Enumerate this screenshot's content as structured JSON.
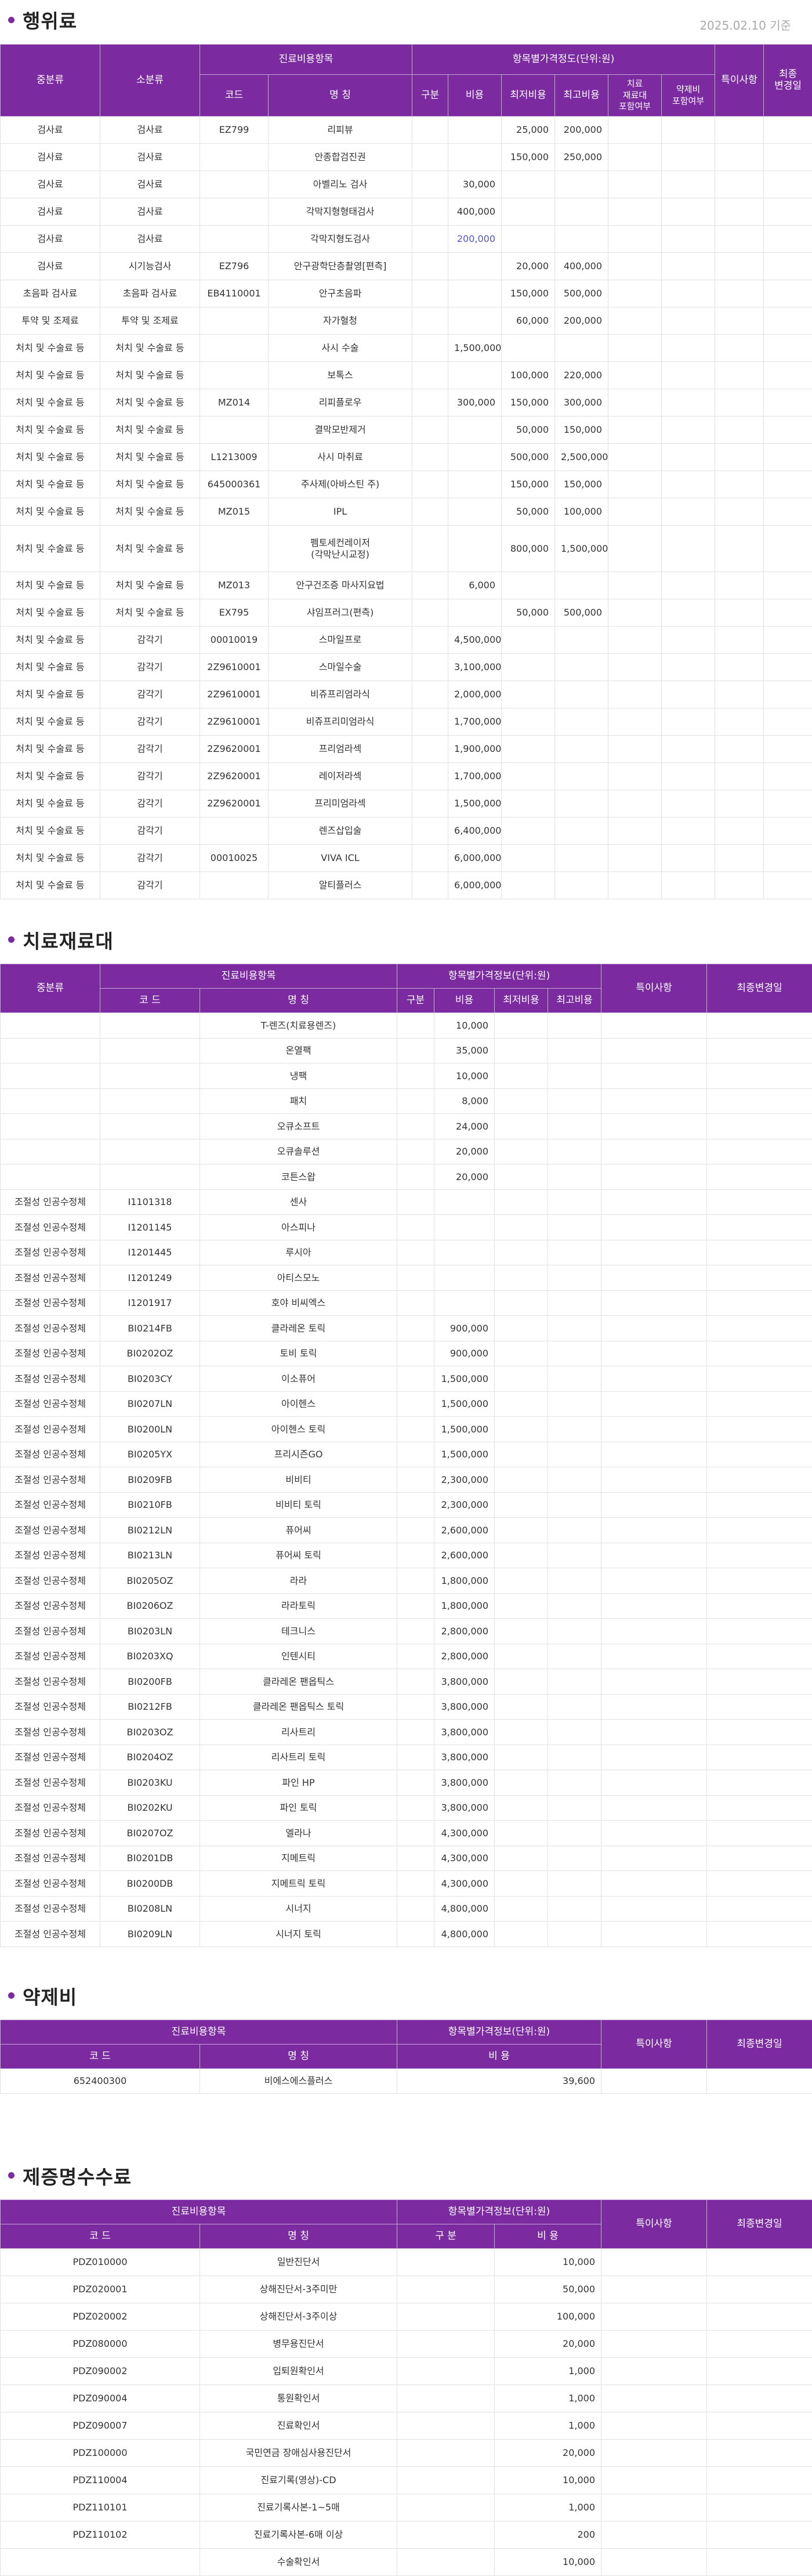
{
  "date_note": "2025.02.10 기준",
  "sections": {
    "s1": "행위료",
    "s2": "치료재료대",
    "s3": "약제비",
    "s4": "제증명수수료"
  },
  "t1": {
    "h_major": "중분류",
    "h_minor": "소분류",
    "h_group1": "진료비용항목",
    "h_group2": "항목별가격정도(단위:원)",
    "h_code": "코드",
    "h_name": "명 칭",
    "h_type": "구분",
    "h_cost": "비용",
    "h_min": "최저비용",
    "h_max": "최고비용",
    "h_mat": "치료\n재료대\n포함여부",
    "h_drug": "약제비\n포함여부",
    "h_special": "특이사항",
    "h_changed": "최종\n변경일",
    "rows": [
      {
        "major": "검사료",
        "minor": "검사료",
        "code": "EZ799",
        "name": "리피뷰",
        "type": "",
        "cost": "",
        "min": "25,000",
        "max": "200,000"
      },
      {
        "major": "검사료",
        "minor": "검사료",
        "code": "",
        "name": "안종합검진권",
        "type": "",
        "cost": "",
        "min": "150,000",
        "max": "250,000"
      },
      {
        "major": "검사료",
        "minor": "검사료",
        "code": "",
        "name": "아벨리노 검사",
        "type": "",
        "cost": "30,000",
        "min": "",
        "max": ""
      },
      {
        "major": "검사료",
        "minor": "검사료",
        "code": "",
        "name": "각막지형형태검사",
        "type": "",
        "cost": "400,000",
        "min": "",
        "max": ""
      },
      {
        "major": "검사료",
        "minor": "검사료",
        "code": "",
        "name": "각막지형도검사",
        "type": "",
        "cost": "200,000",
        "min": "",
        "max": ""
      },
      {
        "major": "검사료",
        "minor": "시기능검사",
        "code": "EZ796",
        "name": "안구광학단층촬영[편측]",
        "type": "",
        "cost": "",
        "min": "20,000",
        "max": "400,000"
      },
      {
        "major": "초음파 검사료",
        "minor": "초음파 검사료",
        "code": "EB4110001",
        "name": "안구초음파",
        "type": "",
        "cost": "",
        "min": "150,000",
        "max": "500,000"
      },
      {
        "major": "투약 및 조제료",
        "minor": "투약 및 조제료",
        "code": "",
        "name": "자가혈청",
        "type": "",
        "cost": "",
        "min": "60,000",
        "max": "200,000"
      },
      {
        "major": "처치 및 수술료 등",
        "minor": "처치 및 수술료 등",
        "code": "",
        "name": "사시 수술",
        "type": "",
        "cost": "1,500,000",
        "min": "",
        "max": ""
      },
      {
        "major": "처치 및 수술료 등",
        "minor": "처치 및 수술료 등",
        "code": "",
        "name": "보톡스",
        "type": "",
        "cost": "",
        "min": "100,000",
        "max": "220,000"
      },
      {
        "major": "처치 및 수술료 등",
        "minor": "처치 및 수술료 등",
        "code": "MZ014",
        "name": "리피플로우",
        "type": "",
        "cost": "300,000",
        "min": "150,000",
        "max": "300,000"
      },
      {
        "major": "처치 및 수술료 등",
        "minor": "처치 및 수술료 등",
        "code": "",
        "name": "결막모반제거",
        "type": "",
        "cost": "",
        "min": "50,000",
        "max": "150,000"
      },
      {
        "major": "처치 및 수술료 등",
        "minor": "처치 및 수술료 등",
        "code": "L1213009",
        "name": "사시 마취료",
        "type": "",
        "cost": "",
        "min": "500,000",
        "max": "2,500,000"
      },
      {
        "major": "처치 및 수술료 등",
        "minor": "처치 및 수술료 등",
        "code": "645000361",
        "name": "주사제(아바스틴 주)",
        "type": "",
        "cost": "",
        "min": "150,000",
        "max": "150,000"
      },
      {
        "major": "처치 및 수술료 등",
        "minor": "처치 및 수술료 등",
        "code": "MZ015",
        "name": "IPL",
        "type": "",
        "cost": "",
        "min": "50,000",
        "max": "100,000"
      },
      {
        "major": "처치 및 수술료 등",
        "minor": "처치 및 수술료 등",
        "code": "",
        "name": "펨토세컨레이저\n(각막난시교정)",
        "type": "",
        "cost": "",
        "min": "800,000",
        "max": "1,500,000"
      },
      {
        "major": "처치 및 수술료 등",
        "minor": "처치 및 수술료 등",
        "code": "MZ013",
        "name": "안구건조증 마사지요법",
        "type": "",
        "cost": "6,000",
        "min": "",
        "max": ""
      },
      {
        "major": "처치 및 수술료 등",
        "minor": "처치 및 수술료 등",
        "code": "EX795",
        "name": "샤임프러그(편측)",
        "type": "",
        "cost": "",
        "min": "50,000",
        "max": "500,000"
      },
      {
        "major": "처치 및 수술료 등",
        "minor": "감각기",
        "code": "00010019",
        "name": "스마일프로",
        "type": "",
        "cost": "4,500,000",
        "min": "",
        "max": ""
      },
      {
        "major": "처치 및 수술료 등",
        "minor": "감각기",
        "code": "2Z9610001",
        "name": "스마일수술",
        "type": "",
        "cost": "3,100,000",
        "min": "",
        "max": ""
      },
      {
        "major": "처치 및 수술료 등",
        "minor": "감각기",
        "code": "2Z9610001",
        "name": "비쥬프리엄라식",
        "type": "",
        "cost": "2,000,000",
        "min": "",
        "max": ""
      },
      {
        "major": "처치 및 수술료 등",
        "minor": "감각기",
        "code": "2Z9610001",
        "name": "비쥬프리미엄라식",
        "type": "",
        "cost": "1,700,000",
        "min": "",
        "max": ""
      },
      {
        "major": "처치 및 수술료 등",
        "minor": "감각기",
        "code": "2Z9620001",
        "name": "프리엄라섹",
        "type": "",
        "cost": "1,900,000",
        "min": "",
        "max": ""
      },
      {
        "major": "처치 및 수술료 등",
        "minor": "감각기",
        "code": "2Z9620001",
        "name": "레이저라섹",
        "type": "",
        "cost": "1,700,000",
        "min": "",
        "max": ""
      },
      {
        "major": "처치 및 수술료 등",
        "minor": "감각기",
        "code": "2Z9620001",
        "name": "프리미엄라섹",
        "type": "",
        "cost": "1,500,000",
        "min": "",
        "max": ""
      },
      {
        "major": "처치 및 수술료 등",
        "minor": "감각기",
        "code": "",
        "name": "렌즈삽입술",
        "type": "",
        "cost": "6,400,000",
        "min": "",
        "max": ""
      },
      {
        "major": "처치 및 수술료 등",
        "minor": "감각기",
        "code": "00010025",
        "name": "VIVA ICL",
        "type": "",
        "cost": "6,000,000",
        "min": "",
        "max": ""
      },
      {
        "major": "처치 및 수술료 등",
        "minor": "감각기",
        "code": "",
        "name": "알티플러스",
        "type": "",
        "cost": "6,000,000",
        "min": "",
        "max": ""
      }
    ]
  },
  "t2": {
    "h_major": "중분류",
    "h_group1": "진료비용항목",
    "h_group2": "항목별가격정보(단위:원)",
    "h_code": "코 드",
    "h_name": "명 칭",
    "h_type": "구분",
    "h_cost": "비용",
    "h_min": "최저비용",
    "h_max": "최고비용",
    "h_special": "특이사항",
    "h_changed": "최종변경일",
    "rows": [
      {
        "major": "",
        "code": "",
        "name": "T-렌즈(치료용렌즈)",
        "type": "",
        "cost": "10,000"
      },
      {
        "major": "",
        "code": "",
        "name": "온열팩",
        "type": "",
        "cost": "35,000"
      },
      {
        "major": "",
        "code": "",
        "name": "냉팩",
        "type": "",
        "cost": "10,000"
      },
      {
        "major": "",
        "code": "",
        "name": "패치",
        "type": "",
        "cost": "8,000"
      },
      {
        "major": "",
        "code": "",
        "name": "오큐소프트",
        "type": "",
        "cost": "24,000"
      },
      {
        "major": "",
        "code": "",
        "name": "오큐솔루션",
        "type": "",
        "cost": "20,000"
      },
      {
        "major": "",
        "code": "",
        "name": "코튼스왑",
        "type": "",
        "cost": "20,000"
      },
      {
        "major": "조절성 인공수정체",
        "code": "I1101318",
        "name": "센사",
        "type": "",
        "cost": ""
      },
      {
        "major": "조절성 인공수정체",
        "code": "I1201145",
        "name": "아스피나",
        "type": "",
        "cost": ""
      },
      {
        "major": "조절성 인공수정체",
        "code": "I1201445",
        "name": "루시아",
        "type": "",
        "cost": ""
      },
      {
        "major": "조절성 인공수정체",
        "code": "I1201249",
        "name": "아티스모노",
        "type": "",
        "cost": ""
      },
      {
        "major": "조절성 인공수정체",
        "code": "I1201917",
        "name": "호야 비씨엑스",
        "type": "",
        "cost": ""
      },
      {
        "major": "조절성 인공수정체",
        "code": "BI0214FB",
        "name": "클라레온 토릭",
        "type": "",
        "cost": "900,000"
      },
      {
        "major": "조절성 인공수정체",
        "code": "BI0202OZ",
        "name": "토비 토릭",
        "type": "",
        "cost": "900,000"
      },
      {
        "major": "조절성 인공수정체",
        "code": "BI0203CY",
        "name": "이소퓨어",
        "type": "",
        "cost": "1,500,000"
      },
      {
        "major": "조절성 인공수정체",
        "code": "BI0207LN",
        "name": "아이헨스",
        "type": "",
        "cost": "1,500,000"
      },
      {
        "major": "조절성 인공수정체",
        "code": "BI0200LN",
        "name": "아이헨스 토릭",
        "type": "",
        "cost": "1,500,000"
      },
      {
        "major": "조절성 인공수정체",
        "code": "BI0205YX",
        "name": "프리시즌GO",
        "type": "",
        "cost": "1,500,000"
      },
      {
        "major": "조절성 인공수정체",
        "code": "BI0209FB",
        "name": "비비티",
        "type": "",
        "cost": "2,300,000"
      },
      {
        "major": "조절성 인공수정체",
        "code": "BI0210FB",
        "name": "비비티 토릭",
        "type": "",
        "cost": "2,300,000"
      },
      {
        "major": "조절성 인공수정체",
        "code": "BI0212LN",
        "name": "퓨어씨",
        "type": "",
        "cost": "2,600,000"
      },
      {
        "major": "조절성 인공수정체",
        "code": "BI0213LN",
        "name": "퓨어씨 토릭",
        "type": "",
        "cost": "2,600,000"
      },
      {
        "major": "조절성 인공수정체",
        "code": "BI0205OZ",
        "name": "라라",
        "type": "",
        "cost": "1,800,000"
      },
      {
        "major": "조절성 인공수정체",
        "code": "BI0206OZ",
        "name": "라라토릭",
        "type": "",
        "cost": "1,800,000"
      },
      {
        "major": "조절성 인공수정체",
        "code": "BI0203LN",
        "name": "테크니스",
        "type": "",
        "cost": "2,800,000"
      },
      {
        "major": "조절성 인공수정체",
        "code": "BI0203XQ",
        "name": "인텐시티",
        "type": "",
        "cost": "2,800,000"
      },
      {
        "major": "조절성 인공수정체",
        "code": "BI0200FB",
        "name": "클라레온 팬옵틱스",
        "type": "",
        "cost": "3,800,000"
      },
      {
        "major": "조절성 인공수정체",
        "code": "BI0212FB",
        "name": "클라레온 팬옵틱스 토릭",
        "type": "",
        "cost": "3,800,000"
      },
      {
        "major": "조절성 인공수정체",
        "code": "BI0203OZ",
        "name": "리사트리",
        "type": "",
        "cost": "3,800,000"
      },
      {
        "major": "조절성 인공수정체",
        "code": "BI0204OZ",
        "name": "리사트리 토릭",
        "type": "",
        "cost": "3,800,000"
      },
      {
        "major": "조절성 인공수정체",
        "code": "BI0203KU",
        "name": "파인 HP",
        "type": "",
        "cost": "3,800,000"
      },
      {
        "major": "조절성 인공수정체",
        "code": "BI0202KU",
        "name": "파인 토릭",
        "type": "",
        "cost": "3,800,000"
      },
      {
        "major": "조절성 인공수정체",
        "code": "BI0207OZ",
        "name": "엘라나",
        "type": "",
        "cost": "4,300,000"
      },
      {
        "major": "조절성 인공수정체",
        "code": "BI0201DB",
        "name": "지메트릭",
        "type": "",
        "cost": "4,300,000"
      },
      {
        "major": "조절성 인공수정체",
        "code": "BI0200DB",
        "name": "지메트릭 토릭",
        "type": "",
        "cost": "4,300,000"
      },
      {
        "major": "조절성 인공수정체",
        "code": "BI0208LN",
        "name": "시너지",
        "type": "",
        "cost": "4,800,000"
      },
      {
        "major": "조절성 인공수정체",
        "code": "BI0209LN",
        "name": "시너지 토릭",
        "type": "",
        "cost": "4,800,000"
      }
    ]
  },
  "t3": {
    "h_group1": "진료비용항목",
    "h_group2": "항목별가격정보(단위:원)",
    "h_code": "코 드",
    "h_name": "명 칭",
    "h_cost": "비 용",
    "h_special": "특이사항",
    "h_changed": "최종변경일",
    "rows": [
      {
        "code": "652400300",
        "name": "비에스에스플러스",
        "cost": "39,600"
      }
    ]
  },
  "t4": {
    "h_group1": "진료비용항목",
    "h_group2": "항목별가격정보(단위:원)",
    "h_code": "코 드",
    "h_name": "명 칭",
    "h_type": "구 분",
    "h_cost": "비 용",
    "h_special": "특이사항",
    "h_changed": "최종변경일",
    "rows": [
      {
        "code": "PDZ010000",
        "name": "일반진단서",
        "cost": "10,000"
      },
      {
        "code": "PDZ020001",
        "name": "상해진단서-3주미만",
        "cost": "50,000"
      },
      {
        "code": "PDZ020002",
        "name": "상해진단서-3주이상",
        "cost": "100,000"
      },
      {
        "code": "PDZ080000",
        "name": "병무용진단서",
        "cost": "20,000"
      },
      {
        "code": "PDZ090002",
        "name": "입퇴원확인서",
        "cost": "1,000"
      },
      {
        "code": "PDZ090004",
        "name": "통원확인서",
        "cost": "1,000"
      },
      {
        "code": "PDZ090007",
        "name": "진료확인서",
        "cost": "1,000"
      },
      {
        "code": "PDZ100000",
        "name": "국민연금 장애심사용진단서",
        "cost": "20,000"
      },
      {
        "code": "PDZ110004",
        "name": "진료기록(영상)-CD",
        "cost": "10,000"
      },
      {
        "code": "PDZ110101",
        "name": "진료기록사본-1~5매",
        "cost": "1,000"
      },
      {
        "code": "PDZ110102",
        "name": "진료기록사본-6매 이상",
        "cost": "200"
      },
      {
        "code": "",
        "name": "수술확인서",
        "cost": "10,000"
      }
    ]
  }
}
